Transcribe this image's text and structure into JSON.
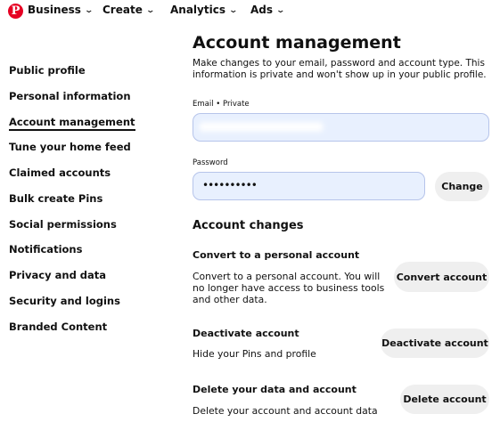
{
  "brand": {
    "logo_glyph": "P",
    "color": "#e60023"
  },
  "nav": {
    "business": "Business",
    "create": "Create",
    "analytics": "Analytics",
    "ads": "Ads",
    "chevron": "⌄"
  },
  "sidebar": {
    "items": [
      {
        "label": "Public profile",
        "active": false
      },
      {
        "label": "Personal information",
        "active": false
      },
      {
        "label": "Account management",
        "active": true
      },
      {
        "label": "Tune your home feed",
        "active": false
      },
      {
        "label": "Claimed accounts",
        "active": false
      },
      {
        "label": "Bulk create Pins",
        "active": false
      },
      {
        "label": "Social permissions",
        "active": false
      },
      {
        "label": "Notifications",
        "active": false
      },
      {
        "label": "Privacy and data",
        "active": false
      },
      {
        "label": "Security and logins",
        "active": false
      },
      {
        "label": "Branded Content",
        "active": false
      }
    ]
  },
  "main": {
    "title": "Account management",
    "description": "Make changes to your email, password and account type. This information is private and won't show up in your public profile.",
    "email_label": "Email • Private",
    "email_value": "",
    "password_label": "Password",
    "password_value": "••••••••••",
    "change_button": "Change",
    "account_changes_heading": "Account changes",
    "convert": {
      "title": "Convert to a personal account",
      "text": "Convert to a personal account. You will no longer have access to business tools and other data.",
      "button": "Convert account"
    },
    "deactivate": {
      "title": "Deactivate account",
      "text": "Hide your Pins and profile",
      "button": "Deactivate account"
    },
    "delete": {
      "title": "Delete your data and account",
      "text": "Delete your account and account data",
      "button": "Delete account"
    }
  },
  "colors": {
    "field_bg": "#e8f0fe",
    "field_border": "#b6c4ea",
    "button_bg": "#efefef"
  }
}
